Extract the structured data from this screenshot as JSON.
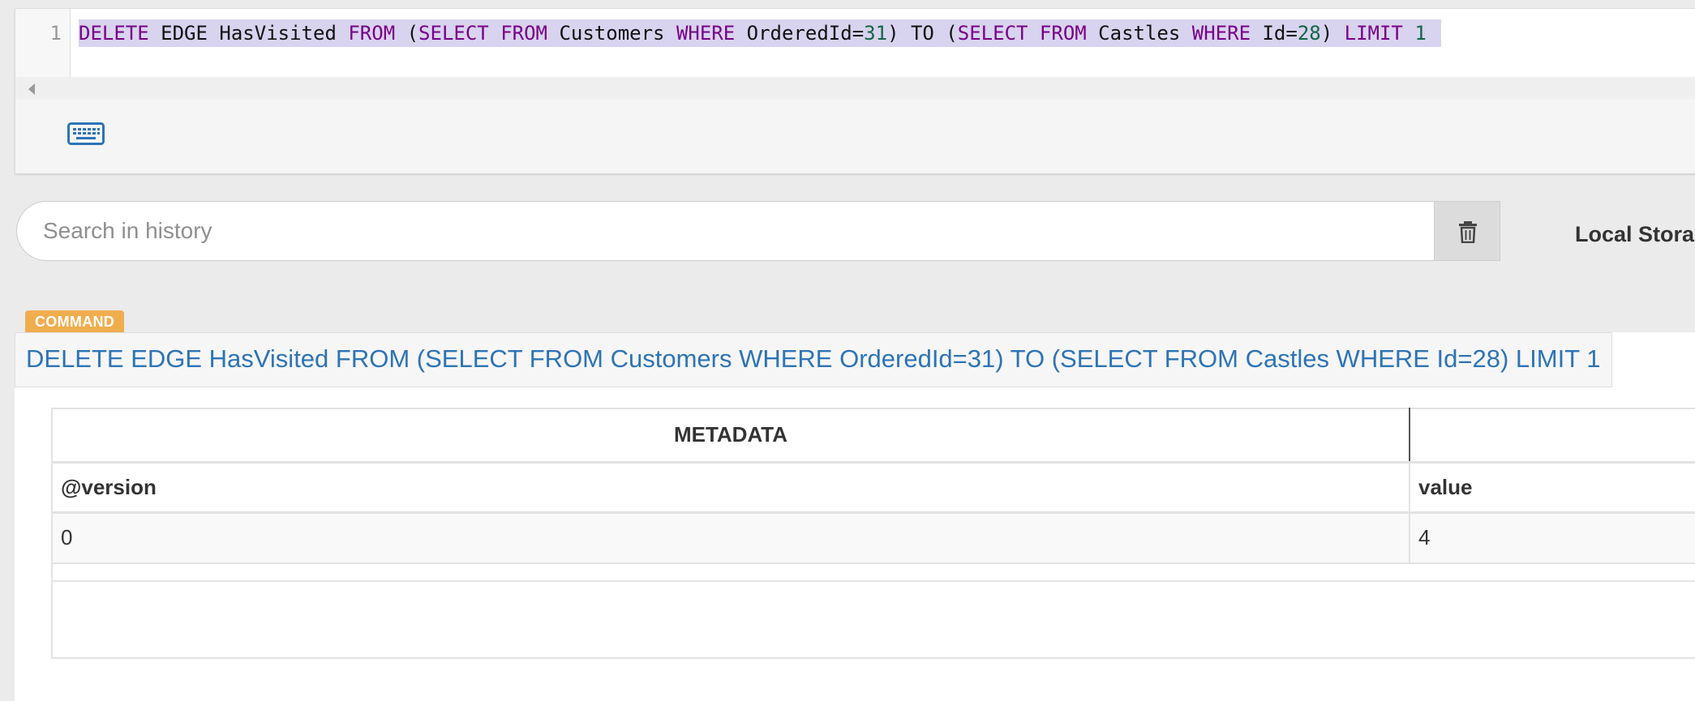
{
  "editor": {
    "line_number": "1",
    "query_tokens": [
      {
        "text": "DELETE",
        "kind": "kw"
      },
      {
        "text": " EDGE HasVisited ",
        "kind": "plain"
      },
      {
        "text": "FROM",
        "kind": "kw"
      },
      {
        "text": " (",
        "kind": "plain"
      },
      {
        "text": "SELECT",
        "kind": "kw"
      },
      {
        "text": " ",
        "kind": "plain"
      },
      {
        "text": "FROM",
        "kind": "kw"
      },
      {
        "text": " Customers ",
        "kind": "plain"
      },
      {
        "text": "WHERE",
        "kind": "kw"
      },
      {
        "text": " OrderedId=",
        "kind": "plain"
      },
      {
        "text": "31",
        "kind": "num"
      },
      {
        "text": ") TO (",
        "kind": "plain"
      },
      {
        "text": "SELECT",
        "kind": "kw"
      },
      {
        "text": " ",
        "kind": "plain"
      },
      {
        "text": "FROM",
        "kind": "kw"
      },
      {
        "text": " Castles ",
        "kind": "plain"
      },
      {
        "text": "WHERE",
        "kind": "kw"
      },
      {
        "text": " Id=",
        "kind": "plain"
      },
      {
        "text": "28",
        "kind": "num"
      },
      {
        "text": ") ",
        "kind": "plain"
      },
      {
        "text": "LIMIT",
        "kind": "kw"
      },
      {
        "text": " ",
        "kind": "plain"
      },
      {
        "text": "1",
        "kind": "num"
      }
    ],
    "keyboard_icon": "keyboard-icon"
  },
  "history": {
    "search_placeholder": "Search in history",
    "search_value": "",
    "clear_icon": "trash-icon",
    "storage_label": "Local Stora"
  },
  "result": {
    "badge": "COMMAND",
    "command_text": "DELETE EDGE HasVisited FROM (SELECT FROM Customers WHERE OrderedId=31) TO (SELECT FROM Castles WHERE Id=28) LIMIT 1",
    "table": {
      "group_header": "METADATA",
      "group_header_2": "",
      "columns": [
        "@version",
        "value"
      ],
      "rows": [
        [
          "0",
          "4"
        ]
      ]
    }
  },
  "colors": {
    "keyword": "#770088",
    "number": "#116644",
    "link": "#2d74b5",
    "badge": "#f0ad4e",
    "selection": "#d8d3ee"
  }
}
